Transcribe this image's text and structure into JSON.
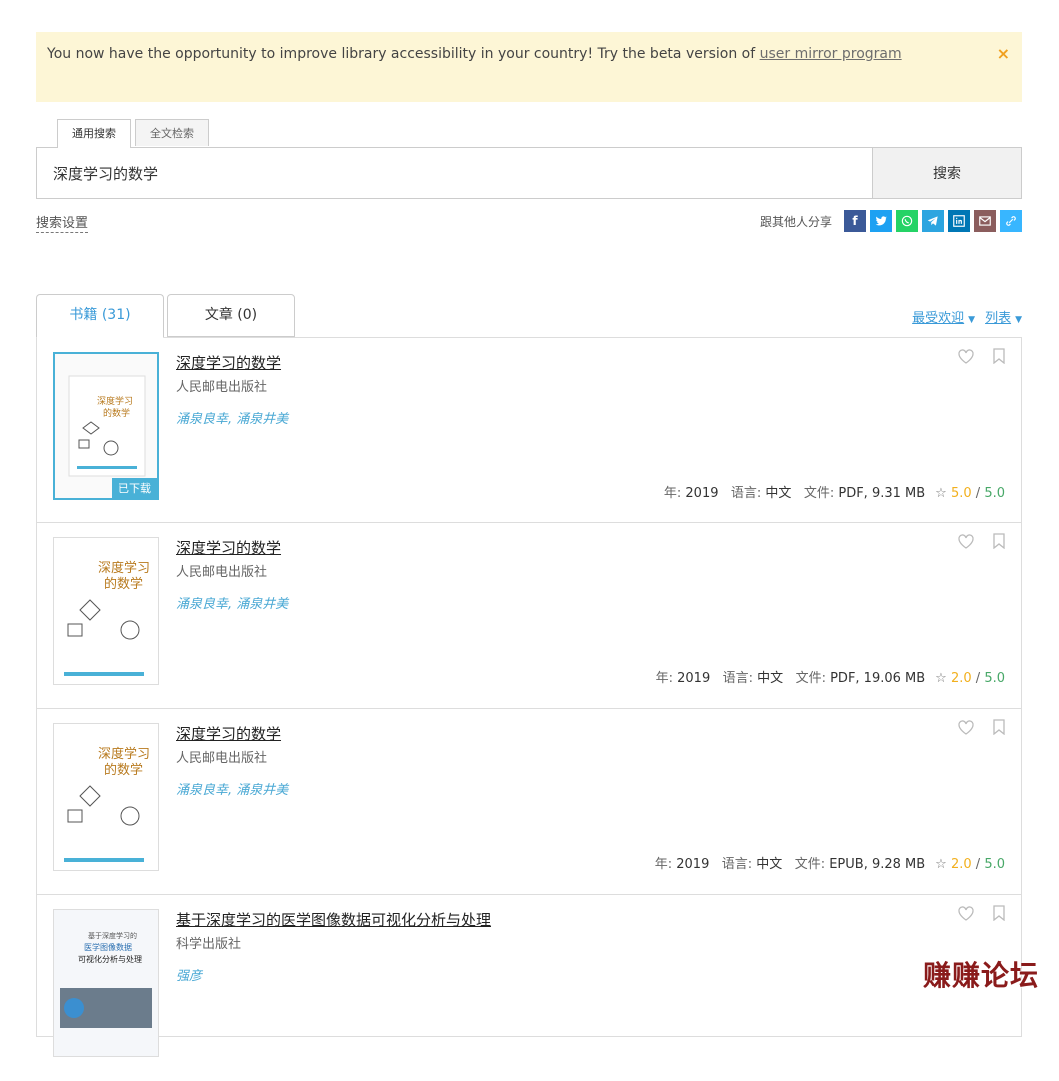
{
  "banner": {
    "text": "You now have the opportunity to improve library accessibility in your country! Try the beta version of ",
    "link": "user mirror program",
    "close": "×"
  },
  "search": {
    "tabs": [
      "通用搜索",
      "全文检索"
    ],
    "value": "深度学习的数学",
    "button": "搜索",
    "settings": "搜索设置"
  },
  "share": {
    "label": "跟其他人分享",
    "icons": [
      {
        "name": "facebook-icon",
        "color": "#3b5998"
      },
      {
        "name": "twitter-icon",
        "color": "#1da1f2"
      },
      {
        "name": "whatsapp-icon",
        "color": "#25d366"
      },
      {
        "name": "telegram-icon",
        "color": "#2ca5e0"
      },
      {
        "name": "linkedin-icon",
        "color": "#0077b5"
      },
      {
        "name": "email-icon",
        "color": "#8b5d5d"
      },
      {
        "name": "link-icon",
        "color": "#38b6ff"
      }
    ]
  },
  "tabs": {
    "books": "书籍 (31)",
    "articles": "文章 (0)"
  },
  "sort": {
    "popular": "最受欢迎",
    "view": "列表"
  },
  "results": [
    {
      "title": "深度学习的数学",
      "publisher": "人民邮电出版社",
      "authors": "涌泉良幸, 涌泉井美",
      "year_label": "年: ",
      "year": "2019",
      "lang_label": "语言: ",
      "lang": "中文",
      "file_label": "文件: ",
      "file": "PDF, 9.31 MB",
      "rating": "5.0",
      "max": "5.0",
      "badge": "已下载"
    },
    {
      "title": "深度学习的数学",
      "publisher": "人民邮电出版社",
      "authors": "涌泉良幸, 涌泉井美",
      "year_label": "年: ",
      "year": "2019",
      "lang_label": "语言: ",
      "lang": "中文",
      "file_label": "文件: ",
      "file": "PDF, 19.06 MB",
      "rating": "2.0",
      "max": "5.0"
    },
    {
      "title": "深度学习的数学",
      "publisher": "人民邮电出版社",
      "authors": "涌泉良幸, 涌泉井美",
      "year_label": "年: ",
      "year": "2019",
      "lang_label": "语言: ",
      "lang": "中文",
      "file_label": "文件: ",
      "file": "EPUB, 9.28 MB",
      "rating": "2.0",
      "max": "5.0"
    },
    {
      "title": "基于深度学习的医学图像数据可视化分析与处理",
      "publisher": "科学出版社",
      "authors": "强彦"
    }
  ],
  "covers": {
    "book1": [
      "深度学习",
      "的数学"
    ],
    "book4": [
      "基于深度学习的",
      "医学图像数据",
      "可视化分析与处理"
    ]
  },
  "watermark": "赚赚论坛"
}
